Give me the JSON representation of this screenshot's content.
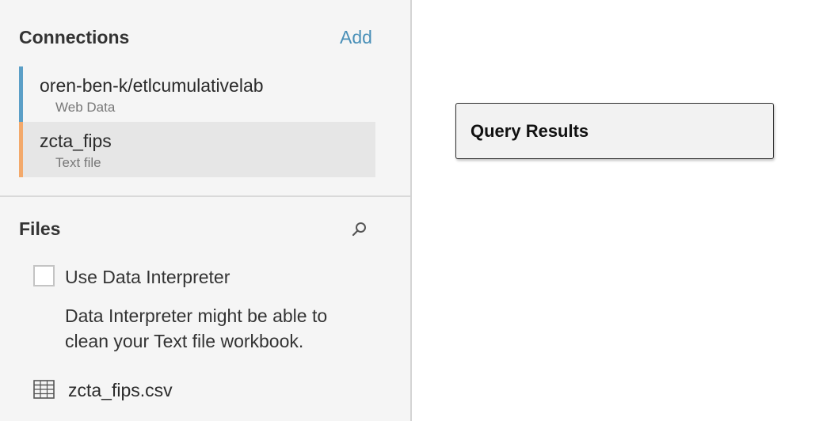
{
  "sidebar": {
    "connections_title": "Connections",
    "add_label": "Add",
    "connections": [
      {
        "name": "oren-ben-k/etlcumulativelab",
        "type": "Web Data",
        "color": "#5b9fc7"
      },
      {
        "name": "zcta_fips",
        "type": "Text file",
        "color": "#f3a96b"
      }
    ],
    "files_title": "Files",
    "search_icon": "search-icon",
    "interpreter": {
      "checkbox_label": "Use Data Interpreter",
      "checked": false,
      "description": "Data Interpreter might be able to clean your Text file workbook."
    },
    "files": [
      {
        "name": "zcta_fips.csv",
        "icon": "table-icon"
      }
    ]
  },
  "canvas": {
    "query_results_title": "Query Results"
  },
  "colors": {
    "accent_link": "#4a90b8",
    "selected_row_bg": "#e6e6e6"
  }
}
